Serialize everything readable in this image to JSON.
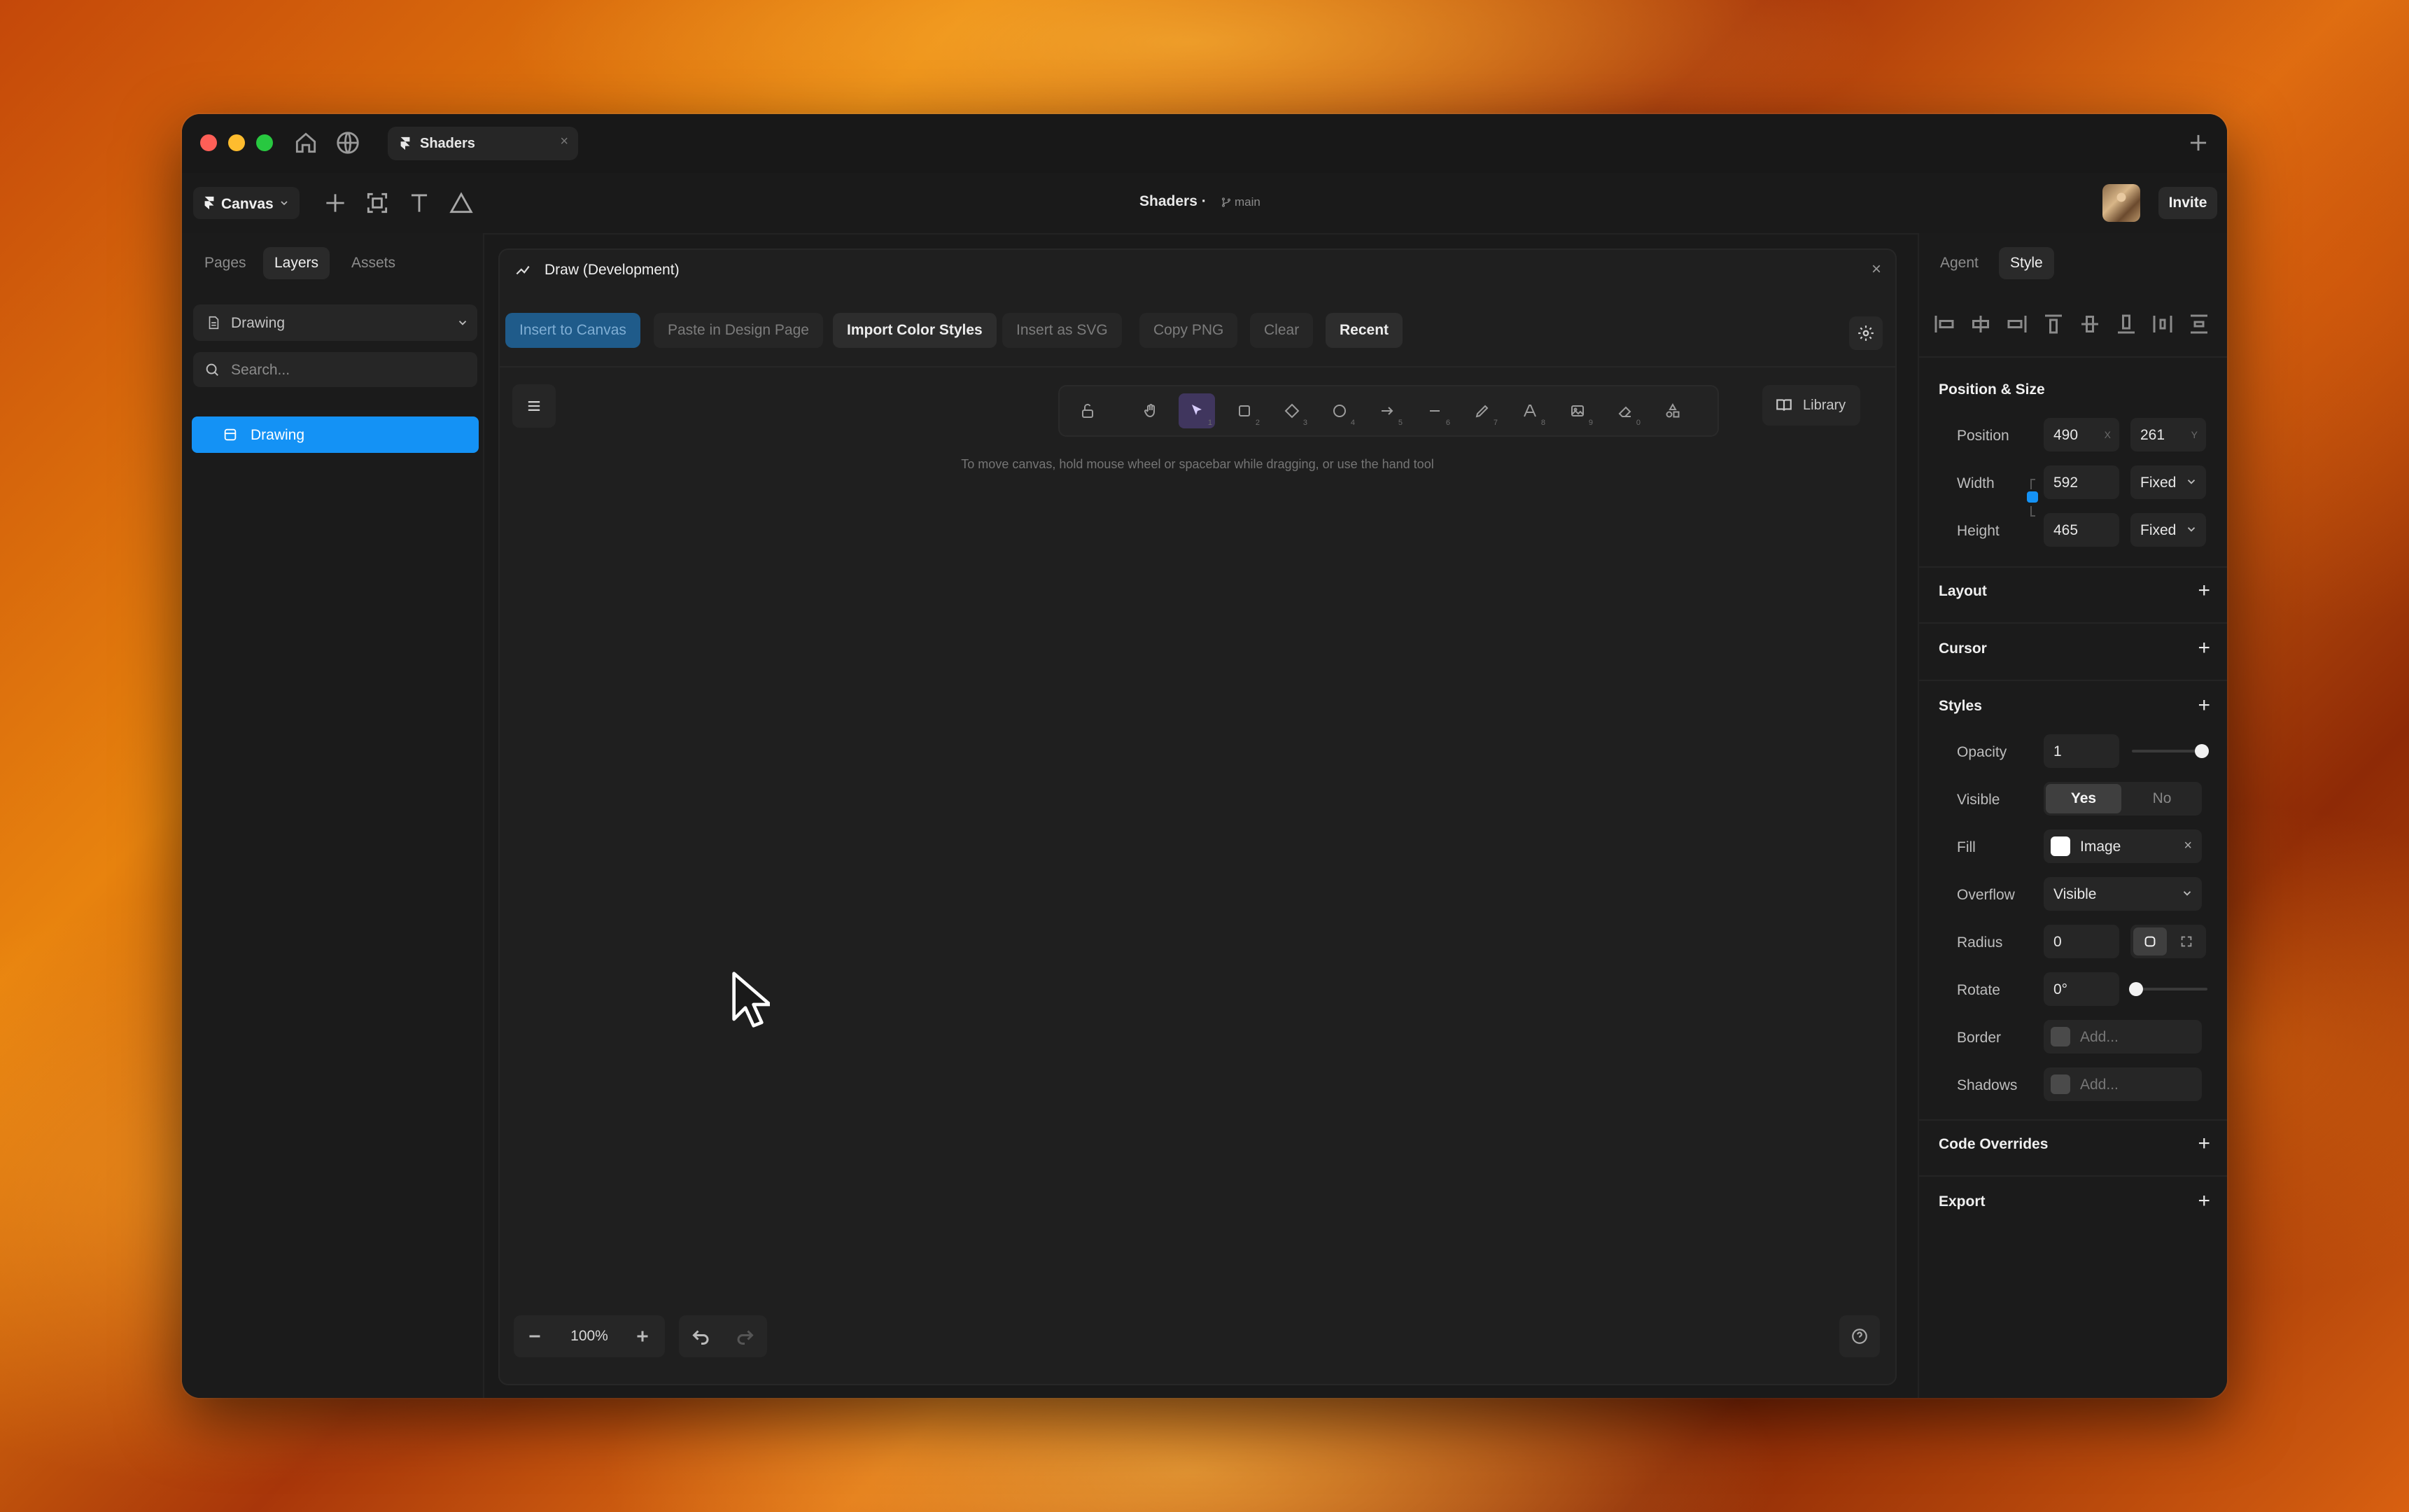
{
  "window": {
    "tab_title": "Shaders",
    "tab_close": "×"
  },
  "toolbar": {
    "canvas_menu": "Canvas",
    "document_title": "Shaders ·",
    "branch": "main",
    "invite_label": "Invite"
  },
  "left_panel": {
    "tabs": [
      "Pages",
      "Layers",
      "Assets"
    ],
    "active_tab": "Layers",
    "page_select": "Drawing",
    "search_placeholder": "Search...",
    "layers": [
      {
        "label": "Drawing",
        "selected": true
      }
    ]
  },
  "plugin": {
    "title": "Draw (Development)",
    "close": "×",
    "actions": {
      "insert_to_canvas": "Insert to Canvas",
      "paste_in_design_page": "Paste in Design Page",
      "import_color_styles": "Import Color Styles",
      "insert_as_svg": "Insert as SVG",
      "copy_png": "Copy PNG",
      "clear": "Clear",
      "recent": "Recent"
    },
    "draw_tools": [
      {
        "name": "lock",
        "shortcut": ""
      },
      {
        "name": "hand",
        "shortcut": ""
      },
      {
        "name": "select",
        "shortcut": "1",
        "selected": true
      },
      {
        "name": "rectangle",
        "shortcut": "2"
      },
      {
        "name": "diamond",
        "shortcut": "3"
      },
      {
        "name": "ellipse",
        "shortcut": "4"
      },
      {
        "name": "arrow",
        "shortcut": "5"
      },
      {
        "name": "line",
        "shortcut": "6"
      },
      {
        "name": "pencil",
        "shortcut": "7"
      },
      {
        "name": "text",
        "shortcut": "8"
      },
      {
        "name": "image",
        "shortcut": "9"
      },
      {
        "name": "eraser",
        "shortcut": "0"
      },
      {
        "name": "shapes",
        "shortcut": ""
      }
    ],
    "library_label": "Library",
    "hint": "To move canvas, hold mouse wheel or spacebar while dragging, or use the hand tool",
    "zoom_value": "100%"
  },
  "right_panel": {
    "tabs": [
      "Agent",
      "Style"
    ],
    "active_tab": "Style",
    "position_size": {
      "title": "Position & Size",
      "position_label": "Position",
      "x": "490",
      "x_suffix": "X",
      "y": "261",
      "y_suffix": "Y",
      "width_label": "Width",
      "width": "592",
      "width_mode": "Fixed",
      "height_label": "Height",
      "height": "465",
      "height_mode": "Fixed"
    },
    "sections": {
      "layout": "Layout",
      "cursor": "Cursor",
      "styles": "Styles",
      "code_overrides": "Code Overrides",
      "export": "Export"
    },
    "styles": {
      "opacity_label": "Opacity",
      "opacity": "1",
      "opacity_level": 1.0,
      "visible_label": "Visible",
      "visible_yes": "Yes",
      "visible_no": "No",
      "visible_selected": "Yes",
      "fill_label": "Fill",
      "fill_value": "Image",
      "fill_color": "#ffffff",
      "overflow_label": "Overflow",
      "overflow_value": "Visible",
      "radius_label": "Radius",
      "radius_value": "0",
      "rotate_label": "Rotate",
      "rotate_value": "0°",
      "border_label": "Border",
      "border_placeholder": "Add...",
      "shadows_label": "Shadows",
      "shadows_placeholder": "Add..."
    }
  },
  "colors": {
    "accent_blue": "#1492f5",
    "selected_tool": "#40365e",
    "panel_bg": "#1b1b1b"
  }
}
